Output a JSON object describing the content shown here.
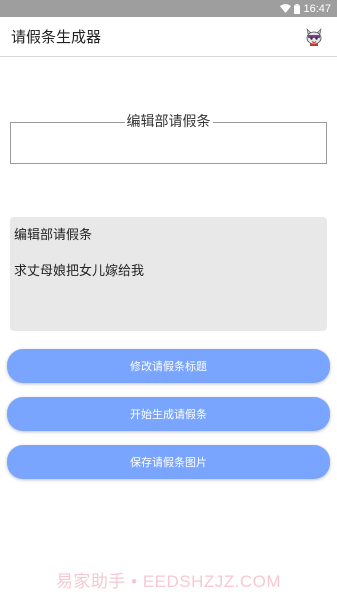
{
  "status_bar": {
    "time": "16:47"
  },
  "app_bar": {
    "title": "请假条生成器",
    "icon": "cartoon-mascot-icon"
  },
  "title_field": {
    "legend": "编辑部请假条",
    "value": ""
  },
  "preview": {
    "title": "编辑部请假条",
    "body": "求丈母娘把女儿嫁给我"
  },
  "buttons": {
    "edit_title": "修改请假条标题",
    "generate": "开始生成请假条",
    "save_image": "保存请假条图片"
  },
  "watermark": "易家助手 • EEDSHZJZ.COM",
  "colors": {
    "button": "#79a5ff",
    "status_bar": "#9e9e9e",
    "preview_bg": "#e8e8e8",
    "watermark": "#f6c9d2"
  }
}
